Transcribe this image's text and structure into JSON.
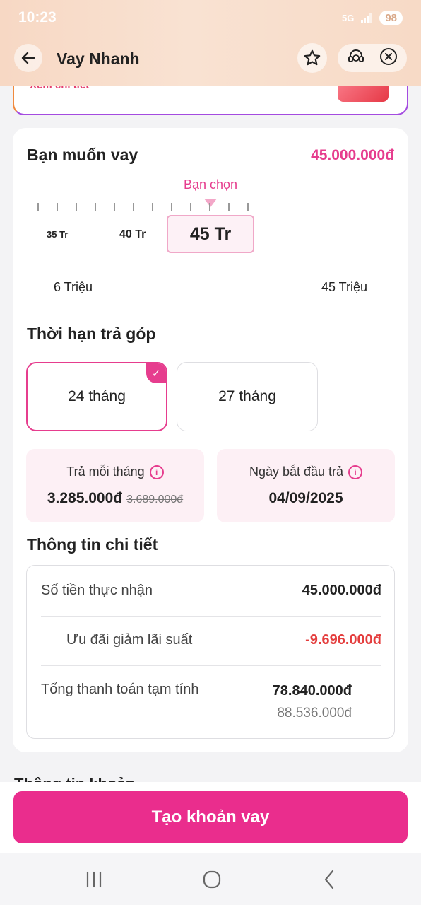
{
  "status_bar": {
    "time": "10:23",
    "network": "5G",
    "battery": "98"
  },
  "header": {
    "title": "Vay Nhanh",
    "back_icon": "arrow-left-icon",
    "favorite_icon": "star-icon",
    "support_icon": "headset-icon",
    "close_icon": "close-circle-icon"
  },
  "promo": {
    "link_text": "Xem chi tiết"
  },
  "loan": {
    "label": "Bạn muốn vay",
    "amount": "45.000.000đ",
    "slider_hint": "Bạn chọn",
    "options": [
      "35 Tr",
      "40 Tr",
      "45 Tr"
    ],
    "selected": "45 Tr",
    "range_min": "6 Triệu",
    "range_max": "45 Triệu"
  },
  "term": {
    "label": "Thời hạn trả góp",
    "options": [
      {
        "label": "24 tháng",
        "selected": true
      },
      {
        "label": "27 tháng",
        "selected": false
      }
    ]
  },
  "summary": {
    "monthly": {
      "title": "Trả mỗi tháng",
      "value": "3.285.000đ",
      "old_value": "3.689.000đ"
    },
    "start": {
      "title": "Ngày bắt đầu trả",
      "value": "04/09/2025"
    }
  },
  "details": {
    "label": "Thông tin chi tiết",
    "rows": [
      {
        "label": "Số tiền thực nhận",
        "value": "45.000.000đ"
      },
      {
        "label": "Ưu đãi giảm lãi suất",
        "value": "-9.696.000đ"
      },
      {
        "label": "Tổng thanh toán tạm tính",
        "value": "78.840.000đ",
        "old_value": "88.536.000đ"
      }
    ]
  },
  "footer": {
    "peek_title": "Thông tin khoản vay",
    "cta_label": "Tạo khoản vay"
  },
  "colors": {
    "accent": "#e63d8e",
    "cta": "#ea2d8d",
    "discount": "#e43d3d",
    "header_bg": "#f8dcc8"
  }
}
